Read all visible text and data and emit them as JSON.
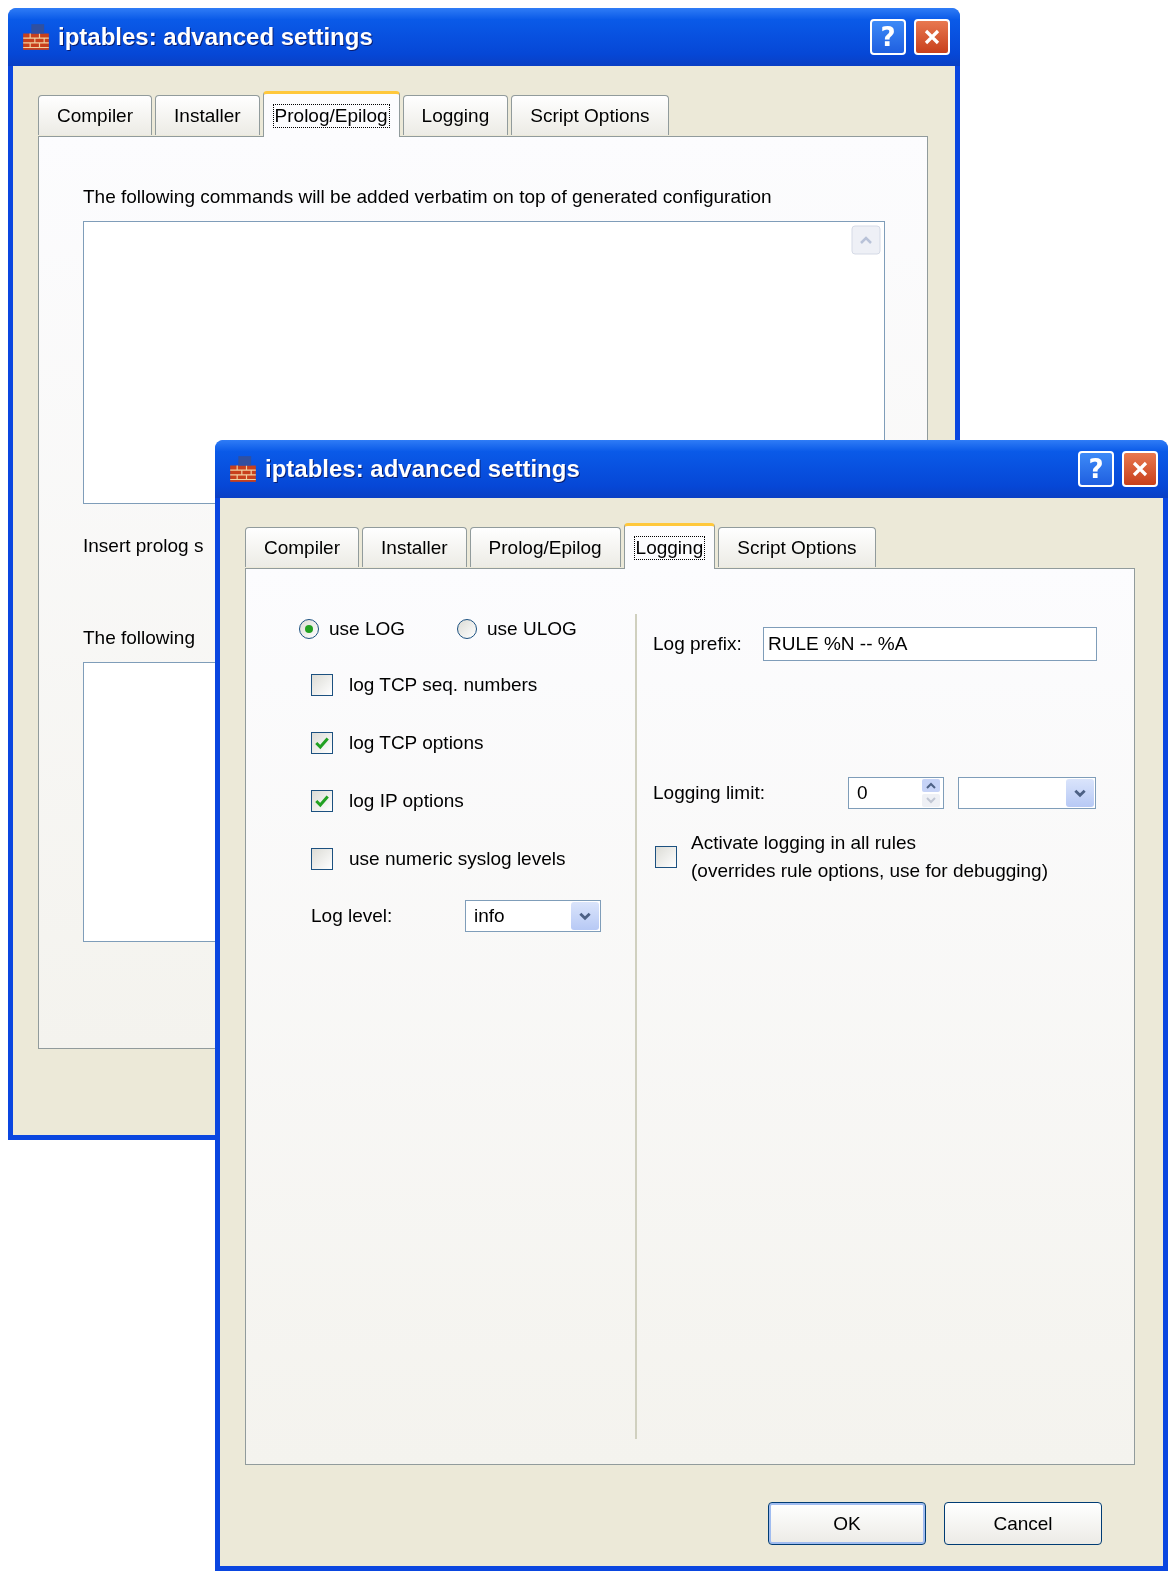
{
  "back_window": {
    "title": "iptables: advanced settings",
    "help_button": "?",
    "tabs": [
      {
        "label": "Compiler",
        "selected": false
      },
      {
        "label": "Installer",
        "selected": false
      },
      {
        "label": "Prolog/Epilog",
        "selected": true
      },
      {
        "label": "Logging",
        "selected": false
      },
      {
        "label": "Script Options",
        "selected": false
      }
    ],
    "prolog_label": "The following commands will be added verbatim on top of generated configuration",
    "insert_label": "Insert prolog s",
    "epilog_label": "The following"
  },
  "front_window": {
    "title": "iptables: advanced settings",
    "help_button": "?",
    "tabs": [
      {
        "label": "Compiler",
        "selected": false
      },
      {
        "label": "Installer",
        "selected": false
      },
      {
        "label": "Prolog/Epilog",
        "selected": false
      },
      {
        "label": "Logging",
        "selected": true
      },
      {
        "label": "Script Options",
        "selected": false
      }
    ],
    "radios": [
      {
        "label": "use LOG",
        "selected": true
      },
      {
        "label": "use ULOG",
        "selected": false
      }
    ],
    "checkboxes": [
      {
        "label": "log TCP seq. numbers",
        "checked": false
      },
      {
        "label": "log TCP options",
        "checked": true
      },
      {
        "label": "log IP options",
        "checked": true
      },
      {
        "label": "use numeric syslog levels",
        "checked": false
      }
    ],
    "log_level": {
      "label": "Log level:",
      "value": "info"
    },
    "log_prefix": {
      "label": "Log prefix:",
      "value": "RULE %N -- %A"
    },
    "logging_limit": {
      "label": "Logging limit:",
      "value": "0"
    },
    "activate_all": {
      "lines": [
        "Activate logging in all rules",
        "(overrides rule options, use for debugging)"
      ],
      "checked": false
    },
    "buttons": [
      "OK",
      "Cancel"
    ]
  }
}
